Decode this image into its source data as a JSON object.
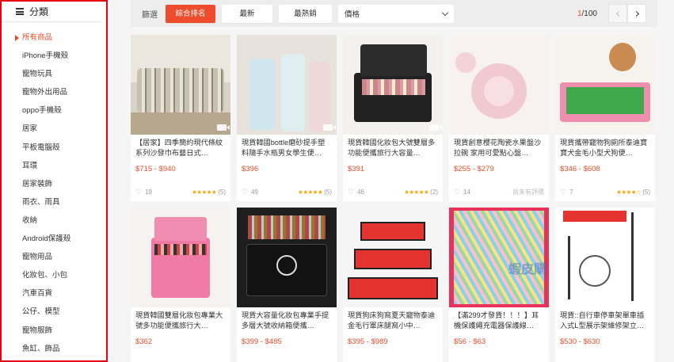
{
  "sidebar": {
    "header": "分類",
    "items": [
      {
        "label": "所有商品",
        "active": true
      },
      {
        "label": "iPhone手機殼"
      },
      {
        "label": "寵物玩具"
      },
      {
        "label": "寵物外出用品"
      },
      {
        "label": "oppo手機殼"
      },
      {
        "label": "居家"
      },
      {
        "label": "平板電腦殼"
      },
      {
        "label": "耳環"
      },
      {
        "label": "居家裝飾"
      },
      {
        "label": "雨衣、雨具"
      },
      {
        "label": "收納"
      },
      {
        "label": "Android保護殼"
      },
      {
        "label": "寵物用品"
      },
      {
        "label": "化妝包、小包"
      },
      {
        "label": "汽車百貨"
      },
      {
        "label": "公仔、模型"
      },
      {
        "label": "寵物服飾"
      },
      {
        "label": "魚缸、飾品"
      }
    ]
  },
  "sortbar": {
    "label": "篩選",
    "relevance": "綜合排名",
    "latest": "最新",
    "top_sales": "最熱銷",
    "price": "價格",
    "page_current": "1",
    "page_total": "/100"
  },
  "products": [
    {
      "title": "【居家】四季簡約現代條紋系列沙發巾布藝日式…",
      "price": "$715 - $940",
      "likes": "19",
      "stars": "★★★★★",
      "reviews": "(5)",
      "video": true
    },
    {
      "title": "現貨韓國bottle磨砂提手塑料隨手水瓶男女學生便…",
      "price": "$396",
      "likes": "49",
      "stars": "★★★★★",
      "reviews": "(5)",
      "video": true
    },
    {
      "title": "現貨韓國化妝包大號雙層多功能便攜旅行大容量…",
      "price": "$391",
      "likes": "46",
      "stars": "★★★★★",
      "reviews": "(2)",
      "video": true
    },
    {
      "title": "現貨創意櫻花陶瓷水果盤沙拉碗 家用可愛點心盤…",
      "price": "$255 - $279",
      "likes": "14",
      "stars": "",
      "reviews": "",
      "norating": "尚未有評價",
      "video": false
    },
    {
      "title": "現貨攜帶寵物狗廁所泰迪寶寶犬金毛小型犬狗便…",
      "price": "$346 - $608",
      "likes": "7",
      "stars": "★★★★☆",
      "reviews": "(5)",
      "video": false
    },
    {
      "title": "現貨韓國雙層化妝包專業大號多功能便攜旅行大…",
      "price": "$362",
      "likes": "",
      "stars": "",
      "reviews": "",
      "video": false
    },
    {
      "title": "現貨大容量化妝包專業手提多層大號收納箱便攜…",
      "price": "$399 - $485",
      "likes": "",
      "stars": "",
      "reviews": "",
      "video": false
    },
    {
      "title": "現貨狗床狗窩夏天寵物泰迪金毛行軍床腿窩小中…",
      "price": "$395 - $989",
      "likes": "",
      "stars": "",
      "reviews": "",
      "video": false
    },
    {
      "title": "【滿299才發貨！！！】耳機保護繩充電器保護線…",
      "price": "$56 - $63",
      "likes": "",
      "stars": "",
      "reviews": "",
      "video": false
    },
    {
      "title": "現貨::自行車停車架單車插入式L型展示架維修架立…",
      "price": "$530 - $630",
      "likes": "",
      "stars": "",
      "reviews": "",
      "video": false
    }
  ],
  "watermark": "蝦皮購"
}
